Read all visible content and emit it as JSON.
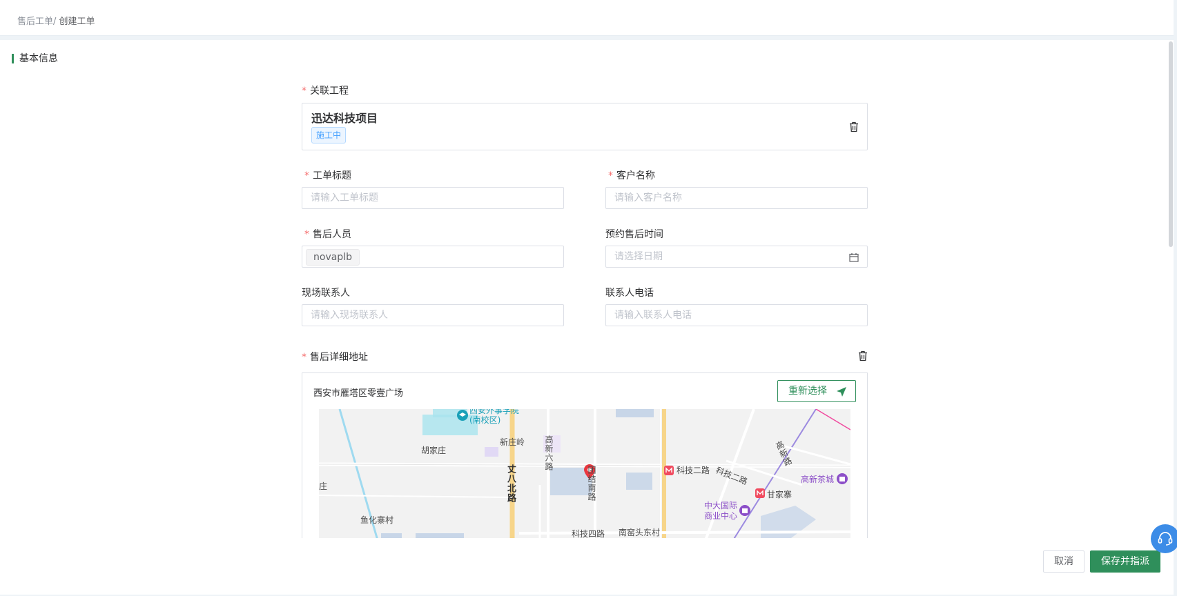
{
  "breadcrumb": {
    "parent": "售后工单/",
    "current": " 创建工单"
  },
  "section": {
    "title": "基本信息"
  },
  "project": {
    "label": "关联工程",
    "name": "迅达科技项目",
    "status_tag": "施工中",
    "delete_icon": "trash-icon"
  },
  "form": {
    "title": {
      "label": "工单标题",
      "placeholder": "请输入工单标题"
    },
    "customer": {
      "label": "客户名称",
      "placeholder": "请输入客户名称"
    },
    "staff": {
      "label": "售后人员",
      "value": "novaplb"
    },
    "appointment": {
      "label": "预约售后时间",
      "placeholder": "请选择日期",
      "icon": "calendar-icon"
    },
    "contact": {
      "label": "现场联系人",
      "placeholder": "请输入现场联系人"
    },
    "phone": {
      "label": "联系人电话",
      "placeholder": "请输入联系人电话"
    }
  },
  "address": {
    "label": "售后详细地址",
    "value": "西安市雁塔区零壹广场",
    "reselect_label": "重新选择",
    "reselect_icon": "send-arrow-icon",
    "delete_icon": "trash-icon"
  },
  "map": {
    "labels": {
      "school": "西安外事学院\n(南校区)",
      "xinzhuangling": "新庄岭",
      "hujiazhuang": "胡家庄",
      "gaoxin6": "高新六路",
      "zhang8": "丈八北路",
      "tuanjie": "团结南路",
      "keji2_station": "科技二路",
      "keji2_road": "科技二路",
      "gaoxin_road": "高新路",
      "gaoxin_tea": "高新茶城",
      "ganjiazhai": "甘家寨",
      "zhongda": "中大国际\n商业中心",
      "zhuang": "庄",
      "yuhuazhai": "鱼化寨村",
      "keji4": "科技四路",
      "nanyaotou": "南窑头东村"
    },
    "colors": {
      "road": "#ffffff",
      "main_road": "#f7d58a",
      "water": "#9fdaf0",
      "metro": "#f04b5f",
      "poi": "#8c4fc8"
    }
  },
  "actions": {
    "cancel": "取消",
    "save": "保存并指派"
  },
  "support": {
    "icon": "headset-icon"
  },
  "colors": {
    "accent": "#2f8f5b",
    "required": "#f56c6c",
    "tag": "#409eff"
  }
}
